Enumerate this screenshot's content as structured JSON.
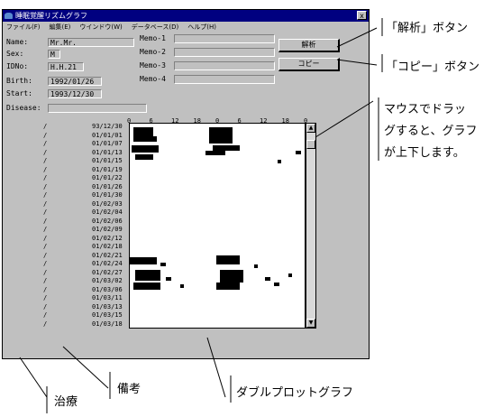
{
  "window": {
    "title": "睡眠覚醒リズムグラフ",
    "close_label": "x",
    "menus": [
      "ファイル(F)",
      "編集(E)",
      "ウインドウ(W)",
      "データベース(D)",
      "ヘルプ(H)"
    ]
  },
  "fields": {
    "name_label": "Name:",
    "name_value": "Mr.Mr.",
    "sex_label": "Sex:",
    "sex_value": "M",
    "idno_label": "IDNo:",
    "idno_value": "H.H.21",
    "birth_label": "Birth:",
    "birth_value": "1992/01/26",
    "start_label": "Start:",
    "start_value": "1993/12/30",
    "disease_label": "Disease:"
  },
  "memos": [
    "Memo-1",
    "Memo-2",
    "Memo-3",
    "Memo-4"
  ],
  "buttons": {
    "analyze": "解析",
    "copy": "コピー"
  },
  "graph": {
    "hour_ticks": [
      "0",
      "6",
      "12",
      "18",
      "0",
      "6",
      "12",
      "18",
      "0"
    ],
    "dates": [
      "93/12/30",
      "01/01/01",
      "01/01/07",
      "01/01/13",
      "01/01/15",
      "01/01/19",
      "01/01/22",
      "01/01/26",
      "01/01/30",
      "01/02/03",
      "01/02/04",
      "01/02/06",
      "01/02/09",
      "01/02/12",
      "01/02/18",
      "01/02/21",
      "01/02/24",
      "01/02/27",
      "01/03/02",
      "01/03/06",
      "01/03/11",
      "01/03/13",
      "01/03/15",
      "01/03/18"
    ],
    "slash": "/"
  },
  "annotations": {
    "analyze": "「解析」ボタン",
    "copy": "「コピー」ボタン",
    "drag": [
      "マウスでドラッ",
      "グすると、グラフ",
      "が上下します。"
    ],
    "treatment": "治療",
    "remarks": "備考",
    "double_plot": "ダブルプロットグラフ"
  }
}
